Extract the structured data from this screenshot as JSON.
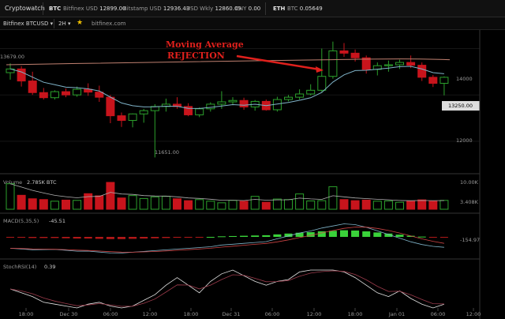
{
  "header": {
    "brand": "Cryptowatch",
    "btc_label": "BTC",
    "prices": [
      {
        "exchange": "Bitfinex",
        "currency": "USD",
        "value": "12899.00"
      },
      {
        "exchange": "Bitstamp",
        "currency": "USD",
        "value": "12936.43"
      },
      {
        "exchange": "USD Wkly",
        "currency": "",
        "value": "12860.09"
      },
      {
        "exchange": "CNY",
        "currency": "",
        "value": "0.00"
      }
    ],
    "eth_label": "ETH",
    "eth_price": {
      "pair": "BTC",
      "value": "0.05649"
    }
  },
  "toolbar": {
    "market": "Bitfinex BTCUSD",
    "market_arrow": "▾",
    "period": "2H",
    "period_arrow": "▾",
    "star": "★",
    "site": "bitfinex.com"
  },
  "annotation": {
    "line1": "Moving Average",
    "line2": "REJECTION",
    "color": "#e0201c"
  },
  "price_panel": {
    "axis_labels": [
      "14000",
      "13250.00",
      "12000"
    ],
    "high_label": "13679.00",
    "low_label": "11651.00"
  },
  "volume_panel": {
    "title": "Volume",
    "value": "2.785K BTC",
    "axis_labels": [
      "10.00K",
      "3.408K"
    ]
  },
  "macd_panel": {
    "title": "MACD(5,35,5)",
    "value": "-45.51",
    "axis_label": "-154.97"
  },
  "rsi_panel": {
    "title": "StochRSI(14)",
    "value": "0.39"
  },
  "time_axis": [
    "18:00",
    "Dec 30",
    "06:00",
    "12:00",
    "18:00",
    "Dec 31",
    "06:00",
    "12:00",
    "18:00",
    "Jan 01",
    "06:00",
    "12:00"
  ],
  "colors": {
    "up": "#2ca02c",
    "down": "#c8141c",
    "ma_fast": "#7fb3c8",
    "ma_slow": "#a86a6a"
  },
  "candles": [
    [
      13480,
      13680,
      13330,
      13560
    ],
    [
      13560,
      13620,
      13180,
      13300
    ],
    [
      13300,
      13500,
      13000,
      13050
    ],
    [
      13050,
      13150,
      12900,
      12940
    ],
    [
      12940,
      13100,
      12900,
      13070
    ],
    [
      13070,
      13140,
      12950,
      13000
    ],
    [
      13000,
      13180,
      12960,
      13120
    ],
    [
      13120,
      13250,
      12980,
      13060
    ],
    [
      13060,
      13200,
      12850,
      12950
    ],
    [
      12950,
      13000,
      12390,
      12550
    ],
    [
      12550,
      12620,
      12310,
      12450
    ],
    [
      12450,
      12600,
      12300,
      12590
    ],
    [
      12590,
      12700,
      12400,
      12660
    ],
    [
      12660,
      12800,
      11651,
      12750
    ],
    [
      12750,
      12920,
      12640,
      12800
    ],
    [
      12800,
      12950,
      12700,
      12750
    ],
    [
      12750,
      12820,
      12540,
      12570
    ],
    [
      12570,
      12730,
      12520,
      12700
    ],
    [
      12700,
      12840,
      12640,
      12800
    ],
    [
      12800,
      13080,
      12700,
      12850
    ],
    [
      12850,
      12950,
      12780,
      12880
    ],
    [
      12880,
      12940,
      12680,
      12740
    ],
    [
      12740,
      12890,
      12660,
      12860
    ],
    [
      12860,
      12900,
      12660,
      12680
    ],
    [
      12680,
      12960,
      12640,
      12900
    ],
    [
      12900,
      13000,
      12860,
      12950
    ],
    [
      12950,
      13120,
      12900,
      13020
    ],
    [
      13020,
      13230,
      12990,
      13100
    ],
    [
      13100,
      14000,
      13060,
      13400
    ],
    [
      13400,
      14150,
      13350,
      13950
    ],
    [
      13950,
      14120,
      13820,
      13900
    ],
    [
      13900,
      13980,
      13720,
      13800
    ],
    [
      13800,
      13850,
      13460,
      13550
    ],
    [
      13550,
      13700,
      13420,
      13630
    ],
    [
      13630,
      13740,
      13500,
      13650
    ],
    [
      13650,
      13760,
      13560,
      13700
    ],
    [
      13700,
      13850,
      13580,
      13640
    ],
    [
      13640,
      13700,
      13300,
      13380
    ],
    [
      13380,
      13430,
      13170,
      13250
    ],
    [
      13250,
      13400,
      12990,
      13380
    ]
  ],
  "volumes": [
    9.5,
    5.2,
    3.9,
    3.6,
    3.0,
    3.4,
    3.3,
    5.8,
    5.0,
    10.0,
    4.2,
    5.1,
    4.0,
    4.6,
    4.8,
    3.9,
    3.2,
    3.6,
    3.0,
    2.4,
    3.3,
    3.0,
    4.8,
    2.6,
    3.8,
    3.6,
    5.7,
    3.1,
    3.2,
    8.4,
    3.6,
    3.2,
    3.4,
    3.0,
    3.1,
    2.6,
    3.0,
    3.5,
    3.0,
    3.3
  ],
  "macd": [
    -0.1,
    -0.15,
    -0.2,
    -0.2,
    -0.2,
    -0.25,
    -0.3,
    -0.3,
    -0.35,
    -0.4,
    -0.4,
    -0.35,
    -0.3,
    -0.25,
    -0.2,
    -0.15,
    -0.1,
    -0.05,
    0.0,
    0.1,
    0.15,
    0.2,
    0.25,
    0.3,
    0.45,
    0.6,
    0.75,
    0.85,
    1.0,
    1.1,
    1.2,
    1.15,
    1.0,
    0.8,
    0.6,
    0.4,
    0.2,
    0.05,
    -0.05,
    -0.1
  ],
  "stochrsi": [
    0.5,
    0.4,
    0.3,
    0.15,
    0.1,
    0.05,
    0.0,
    0.1,
    0.15,
    0.05,
    0.0,
    0.05,
    0.2,
    0.35,
    0.6,
    0.8,
    0.6,
    0.4,
    0.7,
    0.9,
    1.0,
    0.85,
    0.7,
    0.6,
    0.7,
    0.75,
    0.95,
    1.0,
    1.0,
    1.0,
    0.95,
    0.8,
    0.6,
    0.4,
    0.3,
    0.45,
    0.25,
    0.1,
    0.0,
    0.1
  ]
}
